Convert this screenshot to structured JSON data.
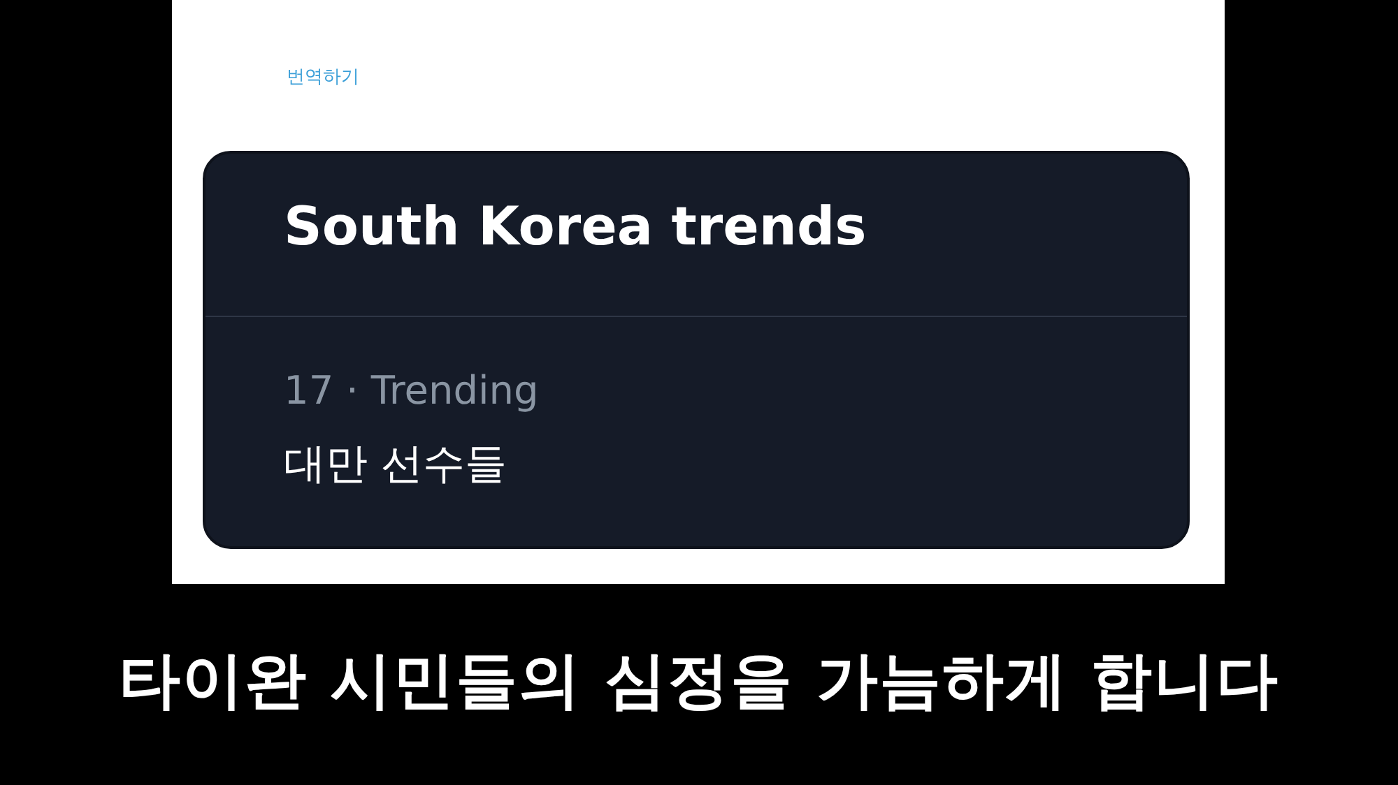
{
  "post": {
    "translate_link": "번역하기"
  },
  "trends_card": {
    "title": "South Korea trends",
    "trends": [
      {
        "meta": "17 · Trending",
        "name": "대만 선수들"
      }
    ]
  },
  "subtitle": "타이완 시민들의 심정을 가늠하게 합니다"
}
